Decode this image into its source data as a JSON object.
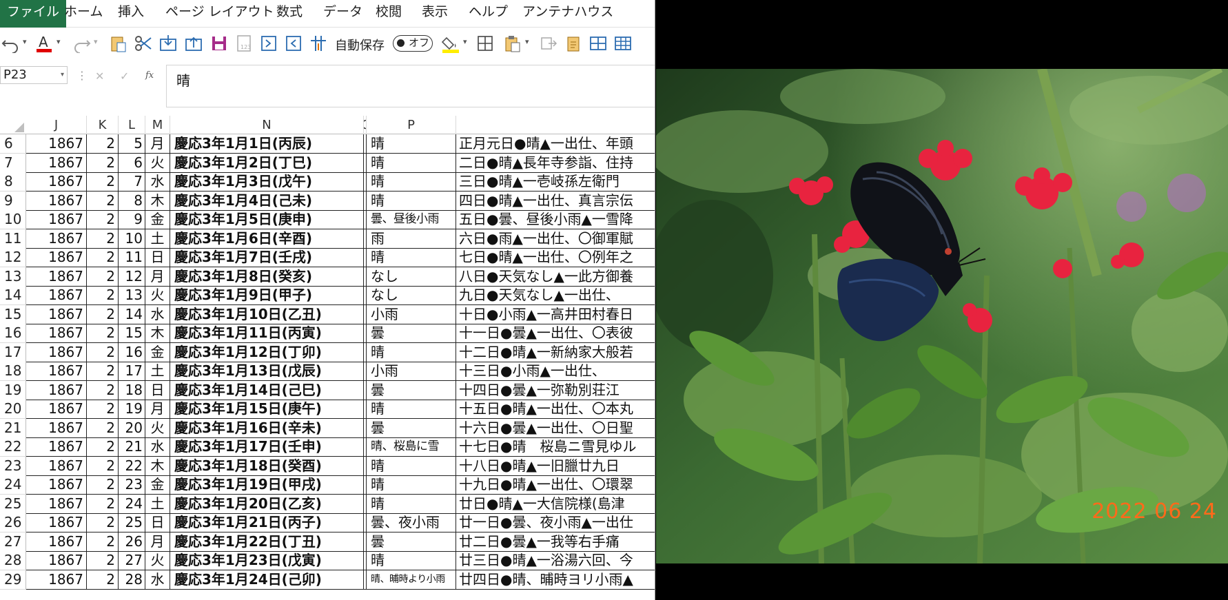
{
  "ribbon": {
    "tabs": [
      "ファイル",
      "ホーム",
      "挿入",
      "ページ レイアウト",
      "数式",
      "データ",
      "校閲",
      "表示",
      "ヘルプ",
      "アンテナハウス"
    ],
    "active_tab": "ファイル",
    "accent_color": "#217346"
  },
  "quick_access": {
    "autosave_label": "自動保存",
    "autosave_state": "オフ",
    "icons": [
      "undo-icon",
      "font-color-icon",
      "redo-icon",
      "paste-special-icon",
      "cut-icon",
      "import-icon",
      "export-icon",
      "save-icon",
      "calculator-icon",
      "insert-sheet-icon",
      "delete-sheet-icon",
      "freeze-pane-icon",
      "fill-color-icon",
      "borders-icon",
      "paste-icon",
      "copy-icon",
      "clipboard-icon",
      "insert-row-icon",
      "insert-table-icon"
    ]
  },
  "formula_bar": {
    "name_box": "P23",
    "fx": "fx",
    "content": "晴"
  },
  "columns": [
    "J",
    "K",
    "L",
    "M",
    "N",
    "O",
    "P"
  ],
  "rows": [
    {
      "rn": "6",
      "j": "1867",
      "k": "2",
      "l": "5",
      "m": "月",
      "n": "慶応3年1月1日(丙辰)",
      "p": "晴",
      "q": "正月元日●晴▲一出仕、年頭"
    },
    {
      "rn": "7",
      "j": "1867",
      "k": "2",
      "l": "6",
      "m": "火",
      "n": "慶応3年1月2日(丁巳)",
      "p": "晴",
      "q": "二日●晴▲長年寺参詣、住持"
    },
    {
      "rn": "8",
      "j": "1867",
      "k": "2",
      "l": "7",
      "m": "水",
      "n": "慶応3年1月3日(戊午)",
      "p": "晴",
      "q": "三日●晴▲一壱岐孫左衛門"
    },
    {
      "rn": "9",
      "j": "1867",
      "k": "2",
      "l": "8",
      "m": "木",
      "n": "慶応3年1月4日(己未)",
      "p": "晴",
      "q": "四日●晴▲一出仕、真言宗伝"
    },
    {
      "rn": "10",
      "j": "1867",
      "k": "2",
      "l": "9",
      "m": "金",
      "n": "慶応3年1月5日(庚申)",
      "p": "曇、昼後小雨",
      "q": "五日●曇、昼後小雨▲一雪降"
    },
    {
      "rn": "11",
      "j": "1867",
      "k": "2",
      "l": "10",
      "m": "土",
      "n": "慶応3年1月6日(辛酉)",
      "p": "雨",
      "q": "六日●雨▲一出仕、〇御軍賦"
    },
    {
      "rn": "12",
      "j": "1867",
      "k": "2",
      "l": "11",
      "m": "日",
      "n": "慶応3年1月7日(壬戌)",
      "p": "晴",
      "q": "七日●晴▲一出仕、〇例年之"
    },
    {
      "rn": "13",
      "j": "1867",
      "k": "2",
      "l": "12",
      "m": "月",
      "n": "慶応3年1月8日(癸亥)",
      "p": "なし",
      "q": "八日●天気なし▲一此方御養"
    },
    {
      "rn": "14",
      "j": "1867",
      "k": "2",
      "l": "13",
      "m": "火",
      "n": "慶応3年1月9日(甲子)",
      "p": "なし",
      "q": "九日●天気なし▲一出仕、"
    },
    {
      "rn": "15",
      "j": "1867",
      "k": "2",
      "l": "14",
      "m": "水",
      "n": "慶応3年1月10日(乙丑)",
      "p": "小雨",
      "q": "十日●小雨▲一高井田村春日"
    },
    {
      "rn": "16",
      "j": "1867",
      "k": "2",
      "l": "15",
      "m": "木",
      "n": "慶応3年1月11日(丙寅)",
      "p": "曇",
      "q": "十一日●曇▲一出仕、〇表彼"
    },
    {
      "rn": "17",
      "j": "1867",
      "k": "2",
      "l": "16",
      "m": "金",
      "n": "慶応3年1月12日(丁卯)",
      "p": "晴",
      "q": "十二日●晴▲一新納家大般若"
    },
    {
      "rn": "18",
      "j": "1867",
      "k": "2",
      "l": "17",
      "m": "土",
      "n": "慶応3年1月13日(戊辰)",
      "p": "小雨",
      "q": "十三日●小雨▲一出仕、"
    },
    {
      "rn": "19",
      "j": "1867",
      "k": "2",
      "l": "18",
      "m": "日",
      "n": "慶応3年1月14日(己巳)",
      "p": "曇",
      "q": "十四日●曇▲一弥勒別荘江"
    },
    {
      "rn": "20",
      "j": "1867",
      "k": "2",
      "l": "19",
      "m": "月",
      "n": "慶応3年1月15日(庚午)",
      "p": "晴",
      "q": "十五日●晴▲一出仕、〇本丸"
    },
    {
      "rn": "21",
      "j": "1867",
      "k": "2",
      "l": "20",
      "m": "火",
      "n": "慶応3年1月16日(辛未)",
      "p": "曇",
      "q": "十六日●曇▲一出仕、〇日聖"
    },
    {
      "rn": "22",
      "j": "1867",
      "k": "2",
      "l": "21",
      "m": "水",
      "n": "慶応3年1月17日(壬申)",
      "p": "晴、桜島に雪",
      "q": "十七日●晴　桜島ニ雪見ゆル"
    },
    {
      "rn": "23",
      "j": "1867",
      "k": "2",
      "l": "22",
      "m": "木",
      "n": "慶応3年1月18日(癸酉)",
      "p": "晴",
      "q": "十八日●晴▲一旧臘廿九日"
    },
    {
      "rn": "24",
      "j": "1867",
      "k": "2",
      "l": "23",
      "m": "金",
      "n": "慶応3年1月19日(甲戌)",
      "p": "晴",
      "q": "十九日●晴▲一出仕、〇環翠"
    },
    {
      "rn": "25",
      "j": "1867",
      "k": "2",
      "l": "24",
      "m": "土",
      "n": "慶応3年1月20日(乙亥)",
      "p": "晴",
      "q": "廿日●晴▲一大信院様(島津"
    },
    {
      "rn": "26",
      "j": "1867",
      "k": "2",
      "l": "25",
      "m": "日",
      "n": "慶応3年1月21日(丙子)",
      "p": "曇、夜小雨",
      "q": "廿一日●曇、夜小雨▲一出仕"
    },
    {
      "rn": "27",
      "j": "1867",
      "k": "2",
      "l": "26",
      "m": "月",
      "n": "慶応3年1月22日(丁丑)",
      "p": "曇",
      "q": "廿二日●曇▲一我等右手痛"
    },
    {
      "rn": "28",
      "j": "1867",
      "k": "2",
      "l": "27",
      "m": "火",
      "n": "慶応3年1月23日(戊寅)",
      "p": "晴",
      "q": "廿三日●晴▲一浴湯六回、今"
    },
    {
      "rn": "29",
      "j": "1867",
      "k": "2",
      "l": "28",
      "m": "水",
      "n": "慶応3年1月24日(己卯)",
      "p": "晴、晡時より小雨",
      "q": "廿四日●晴、晡時ヨリ小雨▲"
    }
  ],
  "photo": {
    "date_stamp": "2022 06 24",
    "date_color": "#ff6a1a",
    "subject_icon": "butterfly-photo"
  }
}
